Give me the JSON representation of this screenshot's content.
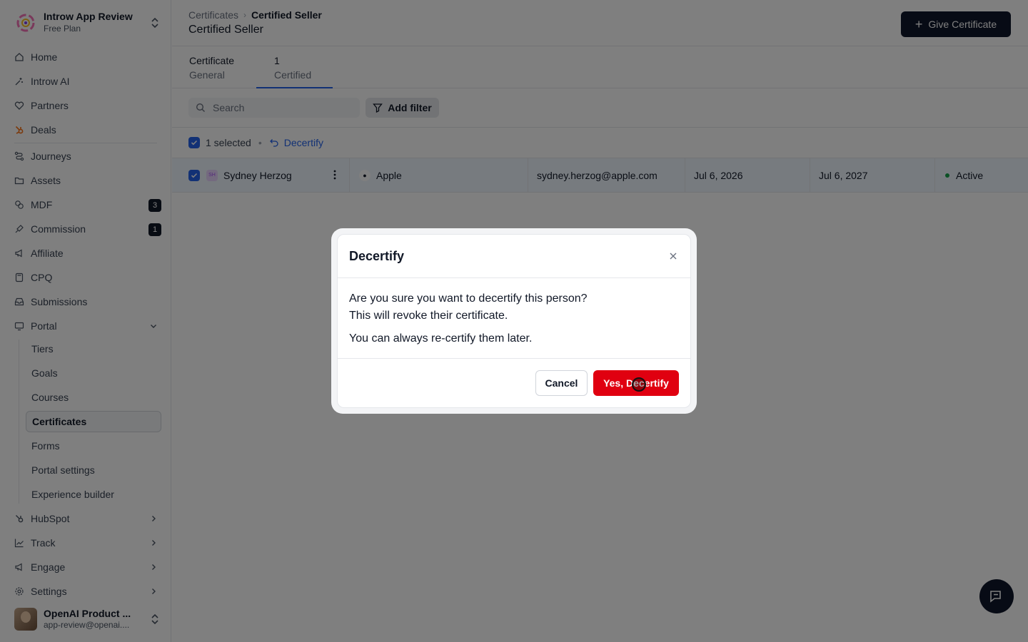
{
  "workspace": {
    "name": "Introw App Review",
    "plan": "Free Plan"
  },
  "nav": {
    "home": "Home",
    "introw_ai": "Introw AI",
    "partners": "Partners",
    "deals": "Deals",
    "journeys": "Journeys",
    "assets": "Assets",
    "mdf": "MDF",
    "mdf_badge": "3",
    "commission": "Commission",
    "commission_badge": "1",
    "affiliate": "Affiliate",
    "cpq": "CPQ",
    "submissions": "Submissions",
    "portal": "Portal",
    "portal_sub": [
      "Tiers",
      "Goals",
      "Courses",
      "Certificates",
      "Forms",
      "Portal settings",
      "Experience builder"
    ],
    "hubspot": "HubSpot",
    "track": "Track",
    "engage": "Engage",
    "settings": "Settings"
  },
  "user": {
    "name": "OpenAI Product ...",
    "email": "app-review@openai...."
  },
  "header": {
    "breadcrumb_parent": "Certificates",
    "breadcrumb_current": "Certified Seller",
    "title": "Certified Seller",
    "give_button": "Give Certificate"
  },
  "tabs": [
    {
      "line1": "Certificate",
      "line2": "General"
    },
    {
      "line1": "1",
      "line2": "Certified"
    }
  ],
  "filters": {
    "search_placeholder": "Search",
    "add_filter": "Add filter"
  },
  "selection": {
    "count_label": "1 selected",
    "action": "Decertify"
  },
  "table_row": {
    "initials": "SH",
    "name": "Sydney Herzog",
    "company": "Apple",
    "email": "sydney.herzog@apple.com",
    "issued": "Jul 6, 2026",
    "expires": "Jul 6, 2027",
    "status": "Active"
  },
  "dialog": {
    "title": "Decertify",
    "line1": "Are you sure you want to decertify this person?",
    "line2": "This will revoke their certificate.",
    "line3": "You can always re-certify them later.",
    "cancel": "Cancel",
    "confirm": "Yes, Decertify"
  },
  "colors": {
    "primary": "#0f172a",
    "accent": "#2563eb",
    "danger": "#e00010",
    "status_active": "#16a34a"
  }
}
